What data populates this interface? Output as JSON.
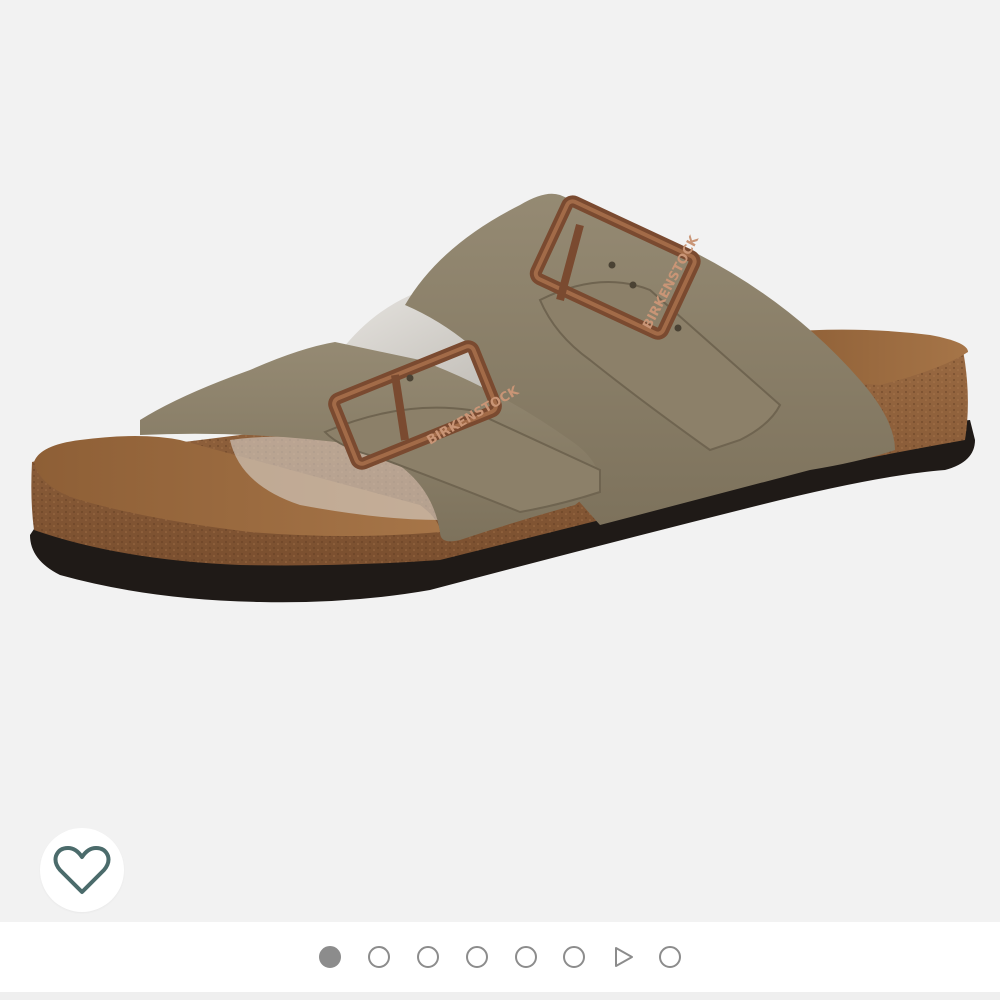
{
  "product_gallery": {
    "image_alt": "Birkenstock Arizona two-strap suede sandal, taupe",
    "buckle_text": "BIRKENSTOCK",
    "wishlist_icon": "heart-outline-icon",
    "carousel": {
      "total": 8,
      "active_index": 0,
      "items": [
        "image",
        "image",
        "image",
        "image",
        "image",
        "image",
        "video",
        "image"
      ]
    }
  },
  "colors": {
    "panel_background": "#f2f2f2",
    "upper_suede": "#8a7d66",
    "cork_footbed": "#8a5a35",
    "sole": "#1f1a17",
    "buckle_copper": "#7a4a30",
    "wishlist_icon": "#4b6b6b",
    "dot": "#8c8c8c"
  }
}
